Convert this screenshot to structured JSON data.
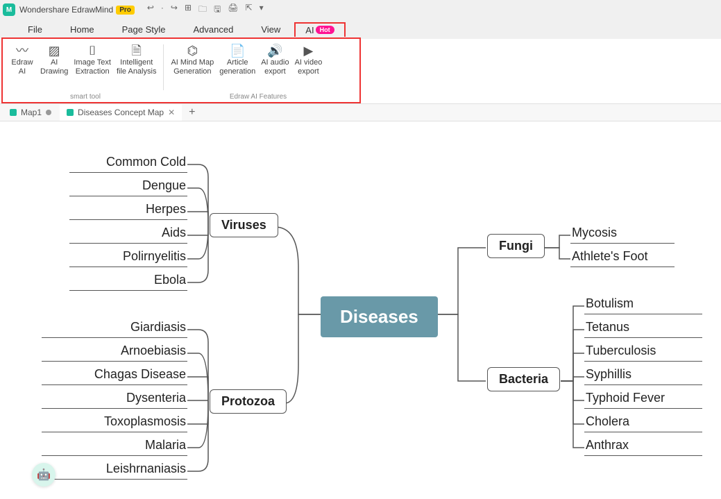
{
  "app": {
    "name": "Wondershare EdrawMind",
    "badge": "Pro"
  },
  "menu": {
    "file": "File",
    "home": "Home",
    "page": "Page Style",
    "advanced": "Advanced",
    "view": "View",
    "ai": "AI",
    "hot": "Hot"
  },
  "ribbon": {
    "group1_label": "smart tool",
    "group2_label": "Edraw AI Features",
    "btn1a": "Edraw",
    "btn1b": "AI",
    "btn2a": "AI",
    "btn2b": "Drawing",
    "btn3a": "Image Text",
    "btn3b": "Extraction",
    "btn4a": "Intelligent",
    "btn4b": "file Analysis",
    "btn5a": "AI Mind Map",
    "btn5b": "Generation",
    "btn6a": "Article",
    "btn6b": "generation",
    "btn7a": "AI audio",
    "btn7b": "export",
    "btn8a": "AI video",
    "btn8b": "export"
  },
  "tabs": {
    "tab1": "Map1",
    "tab2": "Diseases Concept Map"
  },
  "map": {
    "central": "Diseases",
    "viruses": "Viruses",
    "viruses_children": [
      "Common Cold",
      "Dengue",
      "Herpes",
      "Aids",
      "Polirnyelitis",
      "Ebola"
    ],
    "protozoa": "Protozoa",
    "protozoa_children": [
      "Giardiasis",
      "Arnoebiasis",
      "Chagas Disease",
      "Dysenteria",
      "Toxoplasmosis",
      "Malaria",
      "Leishrnaniasis"
    ],
    "fungi": "Fungi",
    "fungi_children": [
      "Mycosis",
      "Athlete's Foot"
    ],
    "bacteria": "Bacteria",
    "bacteria_children": [
      "Botulism",
      "Tetanus",
      "Tuberculosis",
      "Syphillis",
      "Typhoid Fever",
      "Cholera",
      "Anthrax"
    ]
  }
}
